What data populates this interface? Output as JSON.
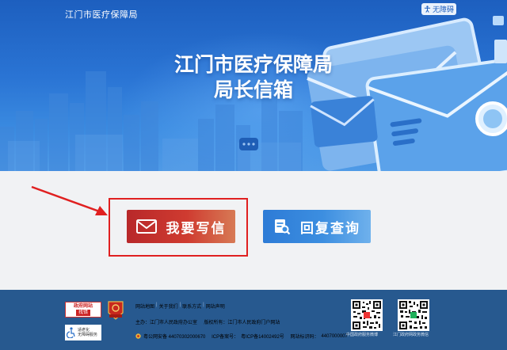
{
  "header": {
    "site_title": "江门市医疗保障局",
    "accessibility_label": "无障碍"
  },
  "hero": {
    "title_line1": "江门市医疗保障局",
    "title_line2": "局长信箱"
  },
  "actions": {
    "write_label": "我要写信",
    "query_label": "回复查询"
  },
  "footer": {
    "gov_badge_line1": "政府网站",
    "gov_badge_line2": "找错",
    "elder_badge_line1": "适老化",
    "elder_badge_line2": "无障碍服务",
    "links": [
      "网站地图",
      "关于我们",
      "联系方式",
      "网站声明"
    ],
    "host_label": "主办：",
    "host_value": "江门市人民政府办公室",
    "copyright_label": "版权所有：",
    "copyright_value": "江门市人民政府门户网站",
    "police_record": "粤公网安备 44070302000670",
    "icp_label": "ICP备案号：",
    "icp_value": "粤ICP备14002492号",
    "site_code_label": "网站标识码：",
    "site_code_value": "4407000007",
    "qr_caption_1": "中国政府服务微博",
    "qr_caption_2": "江门政府网政务微信"
  },
  "colors": {
    "banner_blue": "#2a74d4",
    "write_red": "#c9302c",
    "query_blue": "#3c8ee0",
    "footer_blue": "#27598f",
    "highlight_red": "#e02020"
  }
}
